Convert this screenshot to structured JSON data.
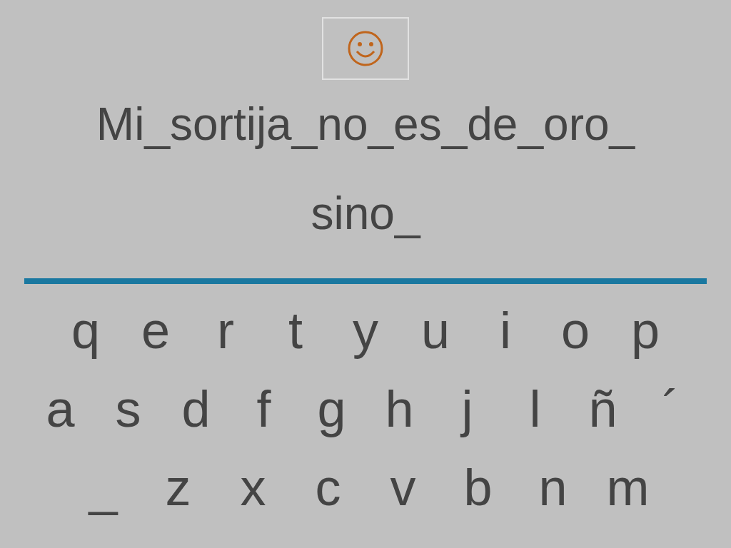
{
  "sentence": [
    "Mi_sortija_no_es_de_oro_",
    "sino_"
  ],
  "keyboard": [
    [
      "q",
      "e",
      "r",
      "t",
      "y",
      "u",
      "i",
      "o",
      "p"
    ],
    [
      "a",
      "s",
      "d",
      "f",
      "g",
      "h",
      "j",
      "l",
      "ñ",
      "´"
    ],
    [
      "_",
      "z",
      "x",
      "c",
      "v",
      "b",
      "n",
      "m"
    ]
  ]
}
